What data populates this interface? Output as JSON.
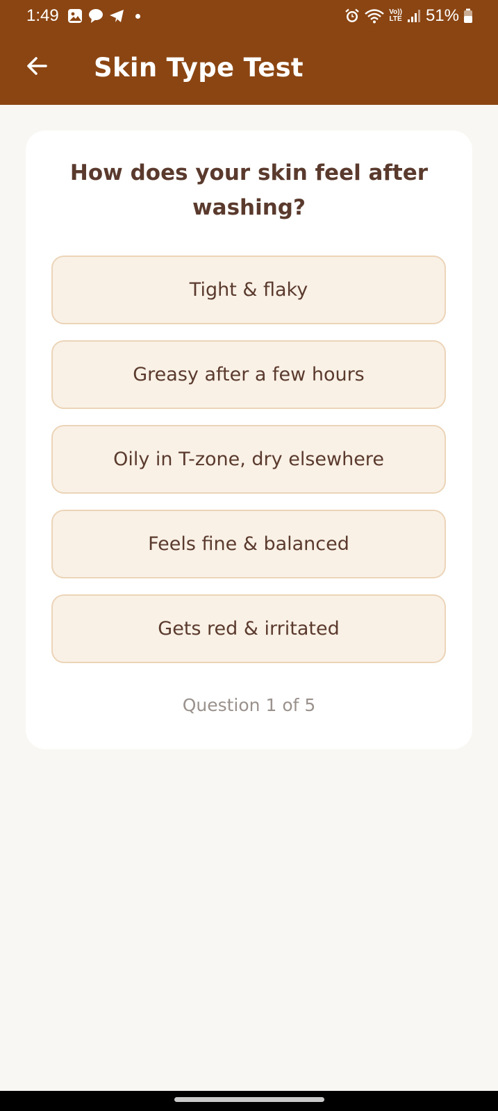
{
  "status_bar": {
    "time": "1:49",
    "left_icons": [
      "gallery-icon",
      "chat-icon",
      "telegram-icon",
      "notification-dot"
    ],
    "right_icons": [
      "alarm-icon",
      "wifi-icon",
      "volte-icon",
      "signal-icon",
      "battery-icon"
    ],
    "volte_line1": "Vo))",
    "volte_line2": "LTE",
    "battery": "51%"
  },
  "app_bar": {
    "title": "Skin Type Test",
    "back_icon": "arrow-left-icon"
  },
  "quiz": {
    "question": "How does your skin feel after washing?",
    "options": [
      {
        "label": "Tight & flaky"
      },
      {
        "label": "Greasy after a few hours"
      },
      {
        "label": "Oily in T-zone, dry elsewhere"
      },
      {
        "label": "Feels fine & balanced"
      },
      {
        "label": "Gets red & irritated"
      }
    ],
    "progress_text": "Question 1 of 5",
    "current": 1,
    "total": 5
  },
  "colors": {
    "brand": "#8b4513",
    "card_bg": "#ffffff",
    "page_bg": "#f9f7f3",
    "option_bg": "#f9f0e6",
    "option_border": "#ecd4b8",
    "text_primary": "#5b3a2e",
    "text_muted": "#9a918c"
  }
}
